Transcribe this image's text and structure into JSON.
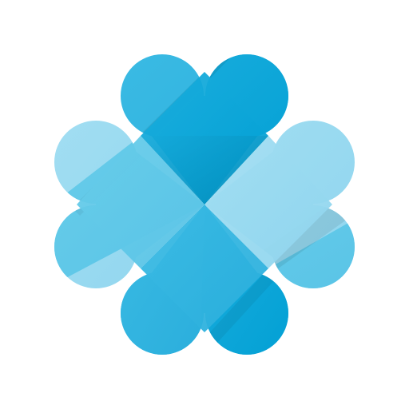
{
  "app": {
    "logo": {
      "icon": "four-leaf-clover-logo-icon",
      "colors": {
        "deep": "#00a6d9",
        "mid": "#32b7e1",
        "soft": "#5cc7e8",
        "light": "#96d9f0"
      }
    }
  }
}
